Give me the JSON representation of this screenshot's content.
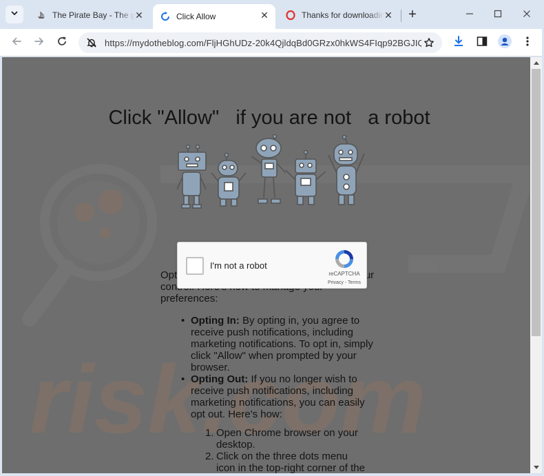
{
  "tabs": [
    {
      "title": "The Pirate Bay - The galaxy's most resilient BitTorrent site",
      "favicon": "pirate-ship-icon",
      "active": false
    },
    {
      "title": "Click Allow",
      "favicon": "loading-spinner-icon",
      "active": true
    },
    {
      "title": "Thanks for downloading Opera",
      "favicon": "opera-icon",
      "active": false
    }
  ],
  "toolbar": {
    "url": "https://mydotheblog.com/FljHGhUDz-20k4QjldqBd0GRzx0hkWS4FIqp92BGJIQ..."
  },
  "page": {
    "headline": "Click \"Allow\"   if you are not   a robot",
    "intro": "Opt in or out of push notifications is within your control. Here's how to manage your preferences:",
    "bullets": [
      {
        "bold": "Opting In:",
        "text": " By opting in, you agree to receive push notifications, including marketing notifications. To opt in, simply click \"Allow\" when prompted by your browser."
      },
      {
        "bold": "Opting Out:",
        "text": " If you no longer wish to receive push notifications, including marketing notifications, you can easily opt out. Here's how:"
      }
    ],
    "steps": [
      {
        "num": "1.",
        "text": "Open Chrome browser on your desktop."
      },
      {
        "num": "2.",
        "text": "Click on the three dots menu icon in the top-right corner of the"
      }
    ]
  },
  "recaptcha": {
    "label": "I'm not a robot",
    "brand": "reCAPTCHA",
    "terms": "Privacy - Terms",
    "checked": false
  },
  "colors": {
    "overlay": "#6e6e6e",
    "tabstrip": "#dbe4f1",
    "accent": "#1a73e8",
    "robot_fill": "#8fa4b8"
  }
}
